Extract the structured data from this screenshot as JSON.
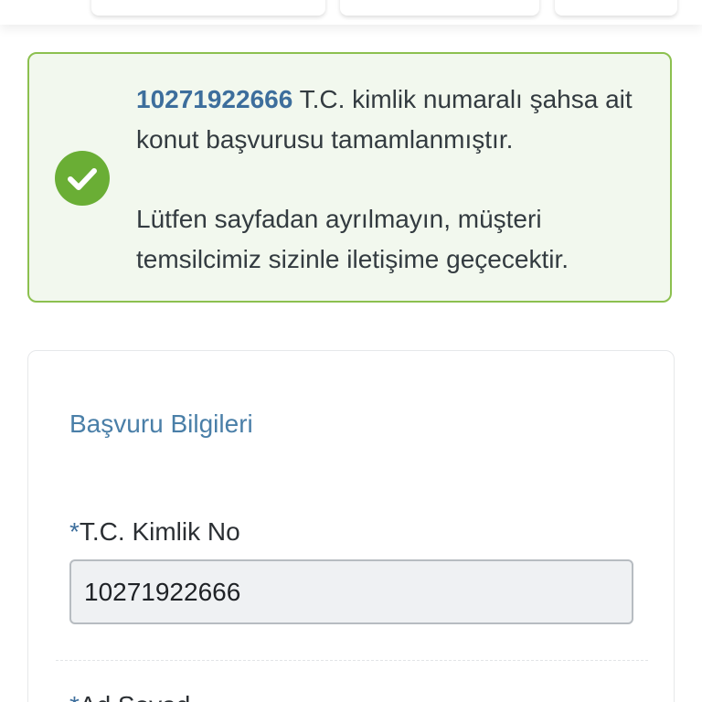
{
  "alert": {
    "tc_number": "10271922666",
    "message_part1": " T.C. kimlik numaralı şahsa ait konut başvurusu tamamlanmıştır.",
    "message_part2": "Lütfen sayfadan ayrılmayın, müşteri temsilcimiz sizinle iletişime geçecektir.",
    "icon": "check-circle-icon",
    "border_color": "#8cc04f",
    "icon_color": "#6aae35"
  },
  "form": {
    "section_title": "Başvuru Bilgileri",
    "fields": [
      {
        "required_mark": "*",
        "label": "T.C. Kimlik No",
        "value": "10271922666"
      },
      {
        "required_mark": "*",
        "label": "Ad Soyad"
      }
    ]
  },
  "colors": {
    "accent_blue": "#3d6e9c",
    "section_title": "#4a7fa8"
  }
}
